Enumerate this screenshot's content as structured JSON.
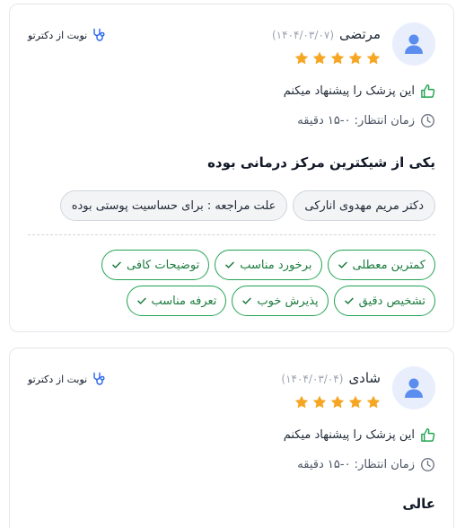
{
  "reviews": [
    {
      "name": "مرتضی",
      "date": "(۱۴۰۴/۰۳/۰۷)",
      "rating": 5,
      "booking_label": "نوبت از دکترتو",
      "recommend_text": "این پزشک را پیشنهاد میکنم",
      "wait_time": "زمان انتظار: ۰-۱۵ دقیقه",
      "comment": "یکی از شیکترین مرکز درمانی بوده",
      "doctor_chip": "دکتر مریم مهدوی انارکی",
      "reason_chip": "علت مراجعه : برای حساسیت پوستی بوده",
      "tags": [
        "کمترین معطلی",
        "برخورد مناسب",
        "توضیحات کافی",
        "تشخیص دقیق",
        "پذیرش خوب",
        "تعرفه مناسب"
      ]
    },
    {
      "name": "شادی",
      "date": "(۱۴۰۴/۰۳/۰۴)",
      "rating": 5,
      "booking_label": "نوبت از دکترتو",
      "recommend_text": "این پزشک را پیشنهاد میکنم",
      "wait_time": "زمان انتظار: ۰-۱۵ دقیقه",
      "comment": "عالی"
    }
  ],
  "colors": {
    "star": "#f5a623",
    "accent_green": "#22a352",
    "avatar_bg": "#e8eefc",
    "avatar_icon": "#5b8def",
    "booking_icon": "#2563eb"
  },
  "icons": {
    "avatar": "user-icon",
    "booking": "stethoscope-icon",
    "recommend": "thumbs-up-icon",
    "wait": "clock-icon",
    "tag": "check-icon",
    "rating": "star-icon"
  }
}
